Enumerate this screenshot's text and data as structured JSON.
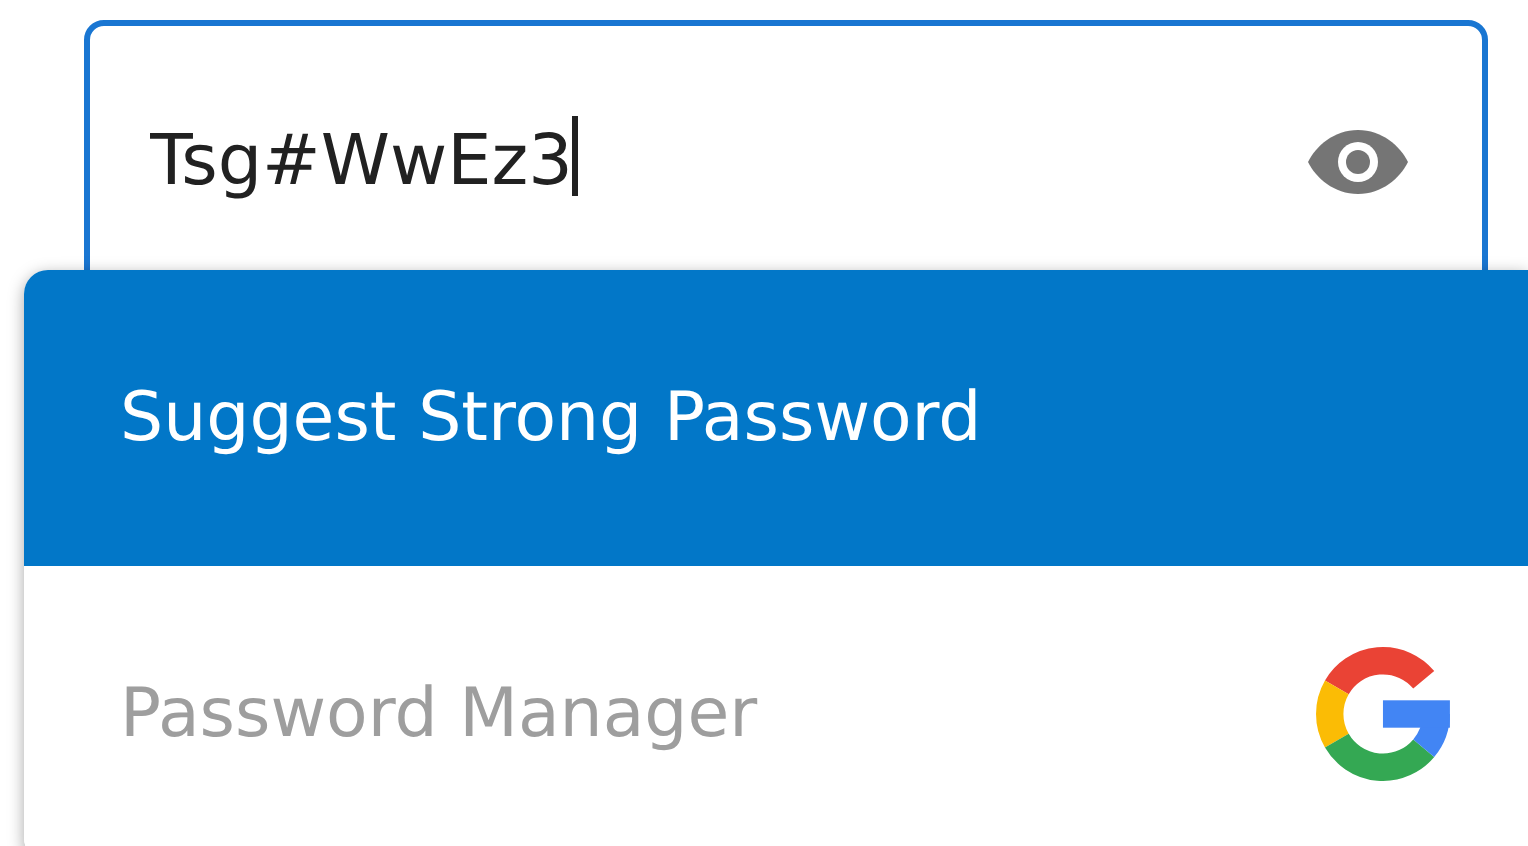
{
  "field": {
    "value": "Tsg#WwEz3",
    "focused": true
  },
  "menu": {
    "items": [
      {
        "label": "Suggest Strong Password",
        "selected": true,
        "kind": "action"
      },
      {
        "label": "Password Manager",
        "selected": false,
        "kind": "manager"
      }
    ]
  }
}
